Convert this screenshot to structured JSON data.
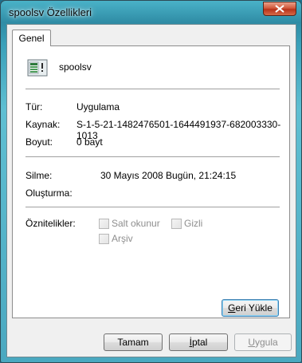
{
  "window": {
    "title": "spoolsv Özellikleri"
  },
  "tabs": [
    {
      "label": "Genel"
    }
  ],
  "file": {
    "name": "spoolsv"
  },
  "info": {
    "type_label": "Tür:",
    "type_value": "Uygulama",
    "source_label": "Kaynak:",
    "source_value": "S-1-5-21-1482476501-1644491937-682003330-1013",
    "size_label": "Boyut:",
    "size_value": "0 bayt"
  },
  "dates": {
    "deleted_label": "Silme:",
    "deleted_value": "30 Mayıs 2008 Bugün, 21:24:15",
    "created_label": "Oluşturma:"
  },
  "attributes": {
    "label": "Öznitelikler:",
    "readonly_label": "Salt okunur",
    "hidden_label": "Gizli",
    "archive_label": "Arşiv"
  },
  "buttons": {
    "restore": {
      "pre": "",
      "u": "G",
      "post": "eri Yükle"
    },
    "ok": "Tamam",
    "cancel": {
      "pre": "",
      "u": "İ",
      "post": "ptal"
    },
    "apply": {
      "pre": "",
      "u": "U",
      "post": "ygula"
    }
  },
  "colors": {
    "accent": "#3c7fb1",
    "titlebar": "#3aa0b9",
    "close": "#c8452a"
  }
}
